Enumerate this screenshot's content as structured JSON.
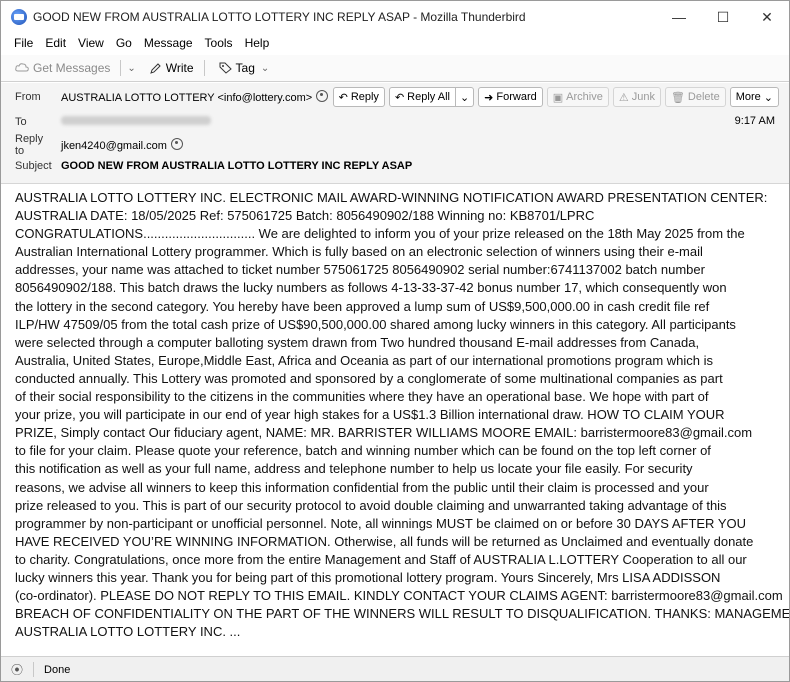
{
  "window": {
    "title": "GOOD NEW FROM AUSTRALIA LOTTO LOTTERY INC REPLY ASAP - Mozilla Thunderbird",
    "minimize": "—",
    "maximize": "☐",
    "close": "✕"
  },
  "menu": [
    "File",
    "Edit",
    "View",
    "Go",
    "Message",
    "Tools",
    "Help"
  ],
  "toolbar": {
    "get_messages": "Get Messages",
    "write": "Write",
    "tag": "Tag"
  },
  "header": {
    "from_label": "From",
    "from_value": "AUSTRALIA LOTTO LOTTERY <info@lottery.com>",
    "to_label": "To",
    "time": "9:17 AM",
    "reply_to_label": "Reply to",
    "reply_to_value": "jken4240@gmail.com",
    "subject_label": "Subject",
    "subject_value": "GOOD NEW FROM AUSTRALIA LOTTO LOTTERY INC REPLY ASAP",
    "buttons": {
      "reply": "Reply",
      "reply_all": "Reply All",
      "forward": "Forward",
      "archive": "Archive",
      "junk": "Junk",
      "delete": "Delete",
      "more": "More"
    }
  },
  "body": {
    "lines": [
      "AUSTRALIA LOTTO LOTTERY INC. ELECTRONIC MAIL AWARD-WINNING NOTIFICATION AWARD PRESENTATION CENTER:",
      "AUSTRALIA DATE: 18/05/2025 Ref: 575061725 Batch: 8056490902/188 Winning no: KB8701/LPRC",
      "CONGRATULATIONS............................... We are delighted to inform you of your prize released on the 18th May 2025 from the",
      "Australian International Lottery programmer. Which is fully based on an electronic selection of winners using their e-mail",
      "addresses, your name was attached to ticket number 575061725 8056490902 serial number:6741137002 batch number",
      "8056490902/188. This batch draws the lucky numbers as follows 4-13-33-37-42 bonus number 17, which consequently won",
      "the lottery in the second category. You hereby have been approved a lump sum of US$9,500,000.00 in cash credit file ref",
      "ILP/HW 47509/05 from the total cash prize of US$90,500,000.00 shared among lucky winners in this category. All participants",
      "were selected through a computer balloting system drawn from Two hundred thousand E-mail addresses from Canada,",
      "Australia, United States, Europe,Middle East, Africa and Oceania as part of our international promotions program which is",
      "conducted annually. This Lottery was promoted and sponsored by a conglomerate of some multinational companies as part",
      "of their social responsibility to the citizens in the communities where they have an operational base. We hope with part of",
      "your prize, you will participate in our end of year high stakes for a US$1.3 Billion international draw. HOW TO CLAIM YOUR",
      "PRIZE, Simply contact Our fiduciary agent, NAME: MR. BARRISTER WILLIAMS MOORE EMAIL: barristermoore83@gmail.com",
      "to file for your claim. Please quote your reference, batch and winning number which can be found on the top left corner of",
      "this notification as well as your full name, address and telephone number to help us locate your file easily. For security",
      "reasons, we advise all winners to keep this information confidential from the public until their claim is processed and your",
      "prize released to you. This is part of our security protocol to avoid double claiming and unwarranted taking advantage of this",
      "programmer by non-participant or unofficial personnel. Note, all winnings MUST be claimed on or before 30 DAYS AFTER YOU",
      "HAVE RECEIVED YOU’RE WINNING INFORMATION. Otherwise, all funds will be returned as Unclaimed and eventually donate",
      "to charity. Congratulations, once more from the entire Management and Staff of AUSTRALIA L.LOTTERY Cooperation to all our",
      "lucky winners this year. Thank you for being part of this promotional lottery program. Yours Sincerely, Mrs LISA ADDISSON",
      "(co-ordinator). PLEASE DO NOT REPLY TO THIS EMAIL. KINDLY CONTACT YOUR CLAIMS AGENT: barristermoore83@gmail.com",
      "BREACH OF CONFIDENTIALITY ON THE PART OF THE WINNERS WILL RESULT TO DISQUALIFICATION. THANKS: MANAGEMENT,",
      "AUSTRALIA LOTTO LOTTERY INC. ..."
    ]
  },
  "status": {
    "text": "Done"
  }
}
